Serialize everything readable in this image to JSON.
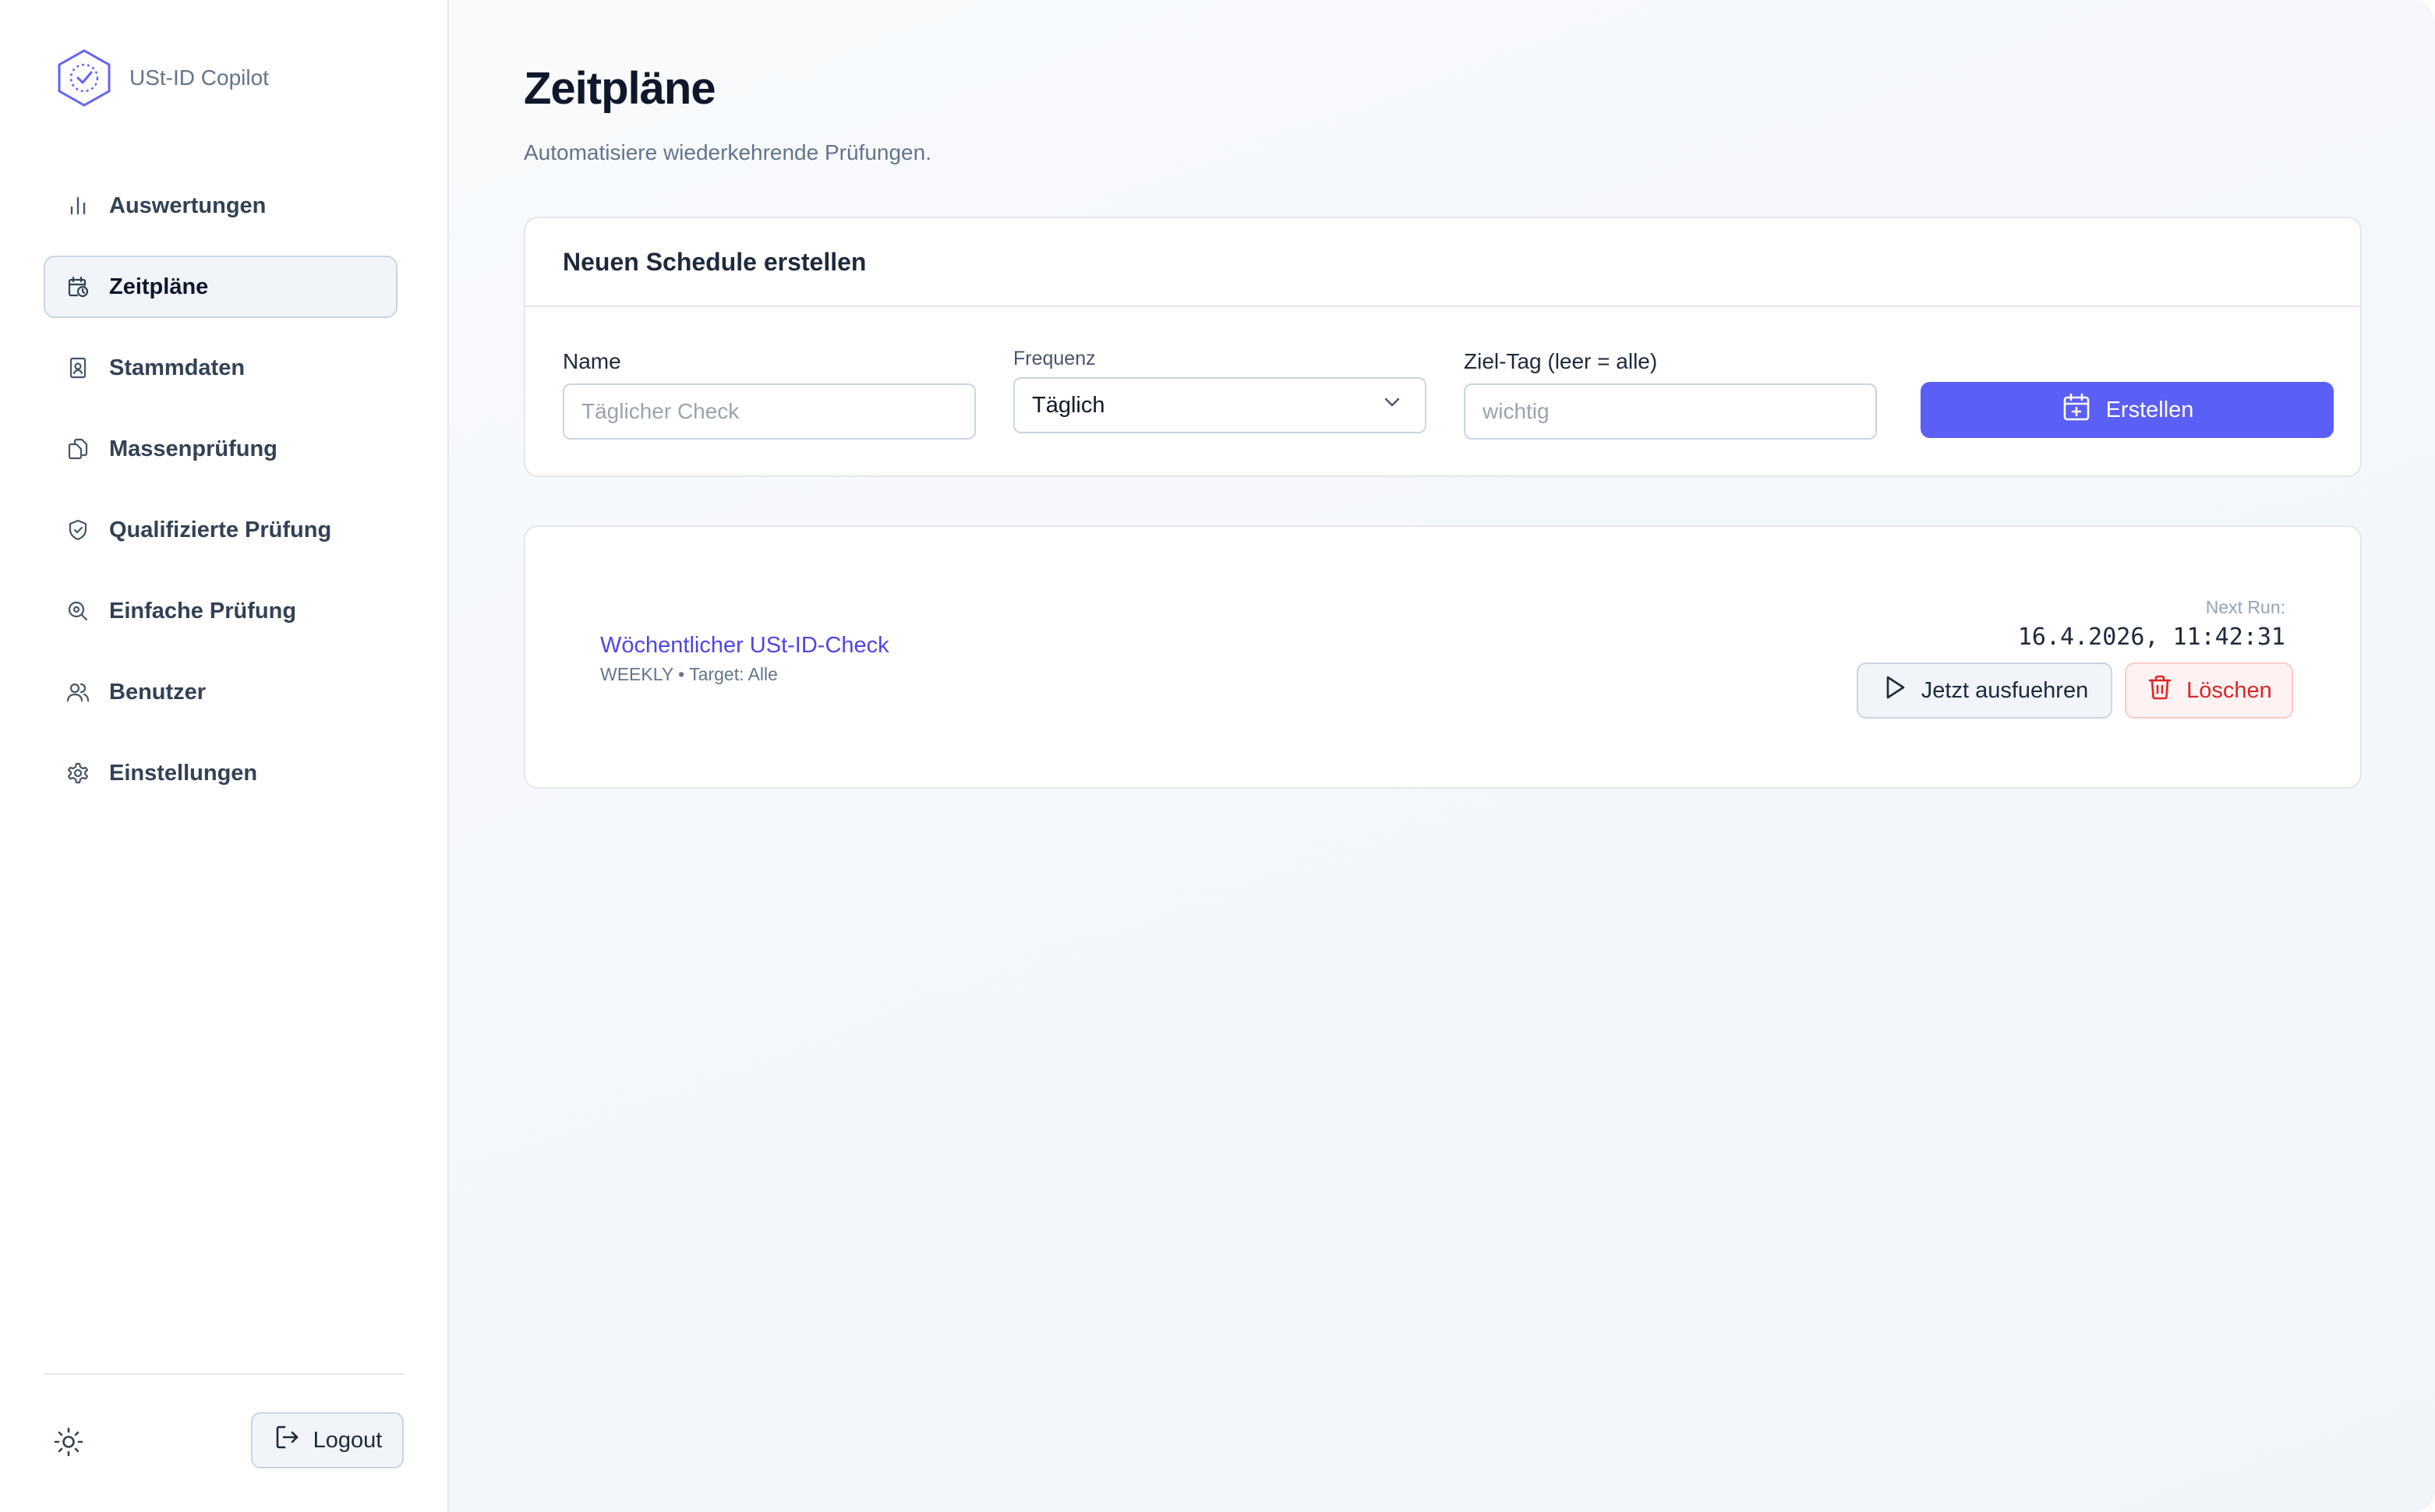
{
  "brand": {
    "name": "USt-ID Copilot",
    "logo_icon": "hexagon-check-logo"
  },
  "sidebar": {
    "items": [
      {
        "label": "Auswertungen",
        "icon": "bar-chart-icon",
        "active": false
      },
      {
        "label": "Zeitpläne",
        "icon": "calendar-clock-icon",
        "active": true
      },
      {
        "label": "Stammdaten",
        "icon": "contact-book-icon",
        "active": false
      },
      {
        "label": "Massenprüfung",
        "icon": "files-icon",
        "active": false
      },
      {
        "label": "Qualifizierte Prüfung",
        "icon": "shield-check-icon",
        "active": false
      },
      {
        "label": "Einfache Prüfung",
        "icon": "search-icon",
        "active": false
      },
      {
        "label": "Benutzer",
        "icon": "users-icon",
        "active": false
      },
      {
        "label": "Einstellungen",
        "icon": "gear-icon",
        "active": false
      }
    ],
    "theme_toggle_icon": "sun-icon",
    "logout_label": "Logout"
  },
  "page": {
    "title": "Zeitpläne",
    "subtitle": "Automatisiere wiederkehrende Prüfungen."
  },
  "create_form": {
    "header": "Neuen Schedule erstellen",
    "name_label": "Name",
    "name_placeholder": "Täglicher Check",
    "frequency_label": "Frequenz",
    "frequency_value": "Täglich",
    "tag_label": "Ziel-Tag (leer = alle)",
    "tag_placeholder": "wichtig",
    "submit_label": "Erstellen"
  },
  "schedules": [
    {
      "name": "Wöchentlicher USt-ID-Check",
      "meta": "WEEKLY • Target: Alle",
      "next_run_label": "Next Run:",
      "next_run_value": "16.4.2026, 11:42:31",
      "run_label": "Jetzt ausfuehren",
      "delete_label": "Löschen"
    }
  ],
  "colors": {
    "accent": "#5b5ff5",
    "link": "#4f46e5",
    "danger": "#dc2626",
    "danger_bg": "#fef2f2"
  }
}
